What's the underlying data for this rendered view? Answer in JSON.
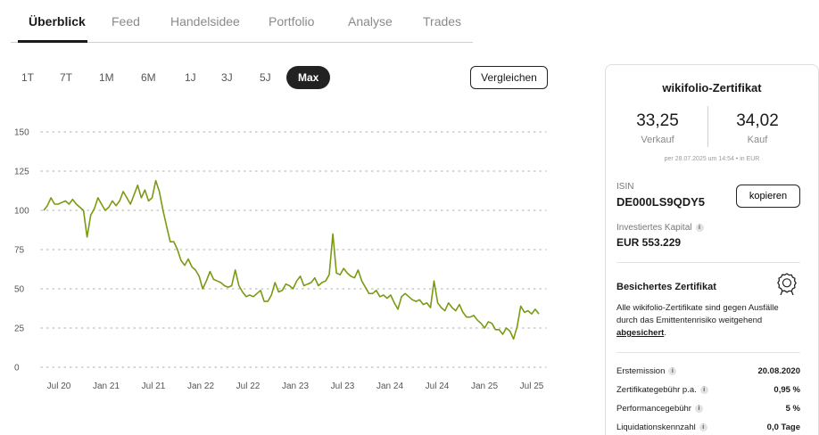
{
  "tabs": [
    "Überblick",
    "Feed",
    "Handelsidee",
    "Portfolio",
    "Analyse",
    "Trades"
  ],
  "active_tab": "Überblick",
  "ranges": [
    "1T",
    "7T",
    "1M",
    "6M",
    "1J",
    "3J",
    "5J",
    "Max"
  ],
  "active_range": "Max",
  "compare_label": "Vergleichen",
  "chart_data": {
    "type": "line",
    "y_ticks": [
      150,
      125,
      100,
      75,
      50,
      25,
      0
    ],
    "ylim": [
      0,
      150
    ],
    "x_ticks": [
      "Jul 20",
      "Jan 21",
      "Jul 21",
      "Jan 22",
      "Jul 22",
      "Jan 23",
      "Jul 23",
      "Jan 24",
      "Jul 24",
      "Jan 25",
      "Jul 25"
    ],
    "grid": "horizontal dotted",
    "line_color": "#7a9a12",
    "series": [
      {
        "values": [
          100,
          103,
          108,
          104,
          104,
          105,
          106,
          104,
          107,
          104,
          102,
          100,
          83,
          97,
          101,
          108,
          104,
          100,
          102,
          106,
          103,
          106,
          112,
          108,
          104,
          110,
          116,
          108,
          113,
          106,
          108,
          119,
          112,
          100,
          90,
          80,
          80,
          75,
          68,
          65,
          69,
          64,
          62,
          58,
          50,
          55,
          61,
          56,
          55,
          54,
          52,
          51,
          52,
          62,
          52,
          48,
          45,
          46,
          45,
          47,
          49,
          42,
          42,
          46,
          54,
          48,
          49,
          53,
          52,
          50,
          55,
          58,
          52,
          53,
          54,
          57,
          52,
          54,
          55,
          59,
          85,
          60,
          59,
          63,
          60,
          58,
          57,
          62,
          55,
          51,
          47,
          47,
          49,
          45,
          46,
          44,
          46,
          41,
          37,
          45,
          47,
          45,
          43,
          42,
          43,
          40,
          41,
          38,
          55,
          41,
          38,
          36,
          41,
          38,
          36,
          40,
          35,
          32,
          32,
          33,
          30,
          28,
          25,
          29,
          28,
          24,
          24,
          21,
          25,
          23,
          18,
          26,
          39,
          35,
          36,
          34,
          37,
          34
        ]
      }
    ]
  },
  "card": {
    "title": "wikifolio-Zertifikat",
    "sell_price": "33,25",
    "sell_label": "Verkauf",
    "buy_price": "34,02",
    "buy_label": "Kauf",
    "price_note": "per 28.07.2025 um 14:54 • in EUR",
    "isin_label": "ISIN",
    "isin": "DE000LS9QDY5",
    "copy_label": "kopieren",
    "capital_label": "Investiertes Kapital",
    "capital": "EUR 553.229",
    "secured_title": "Besichertes Zertifikat",
    "secured_text": "Alle wikifolio-Zertifikate sind gegen Ausfälle durch das Emittentenrisiko weitgehend",
    "secured_link": "abgesichert",
    "secured_end": ".",
    "rows": [
      {
        "label": "Erstemission",
        "value": "20.08.2020"
      },
      {
        "label": "Zertifikategebühr p.a.",
        "value": "0,95 %"
      },
      {
        "label": "Performancegebühr",
        "value": "5 %"
      },
      {
        "label": "Liquidationskennzahl",
        "value": "0,0 Tage"
      }
    ]
  }
}
